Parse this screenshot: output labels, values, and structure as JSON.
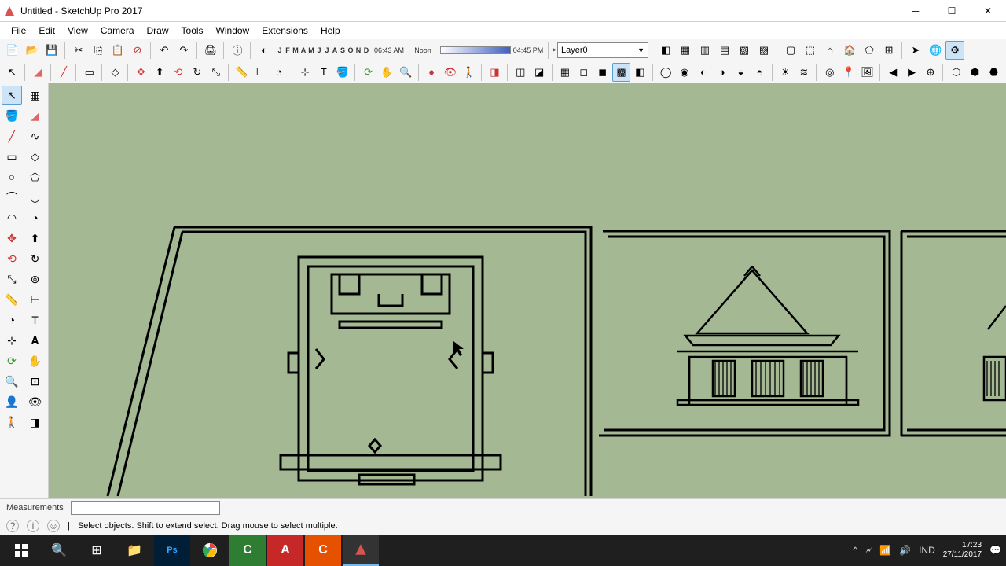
{
  "window": {
    "title": "Untitled - SketchUp Pro 2017"
  },
  "menu": {
    "file": "File",
    "edit": "Edit",
    "view": "View",
    "camera": "Camera",
    "draw": "Draw",
    "tools": "Tools",
    "window": "Window",
    "extensions": "Extensions",
    "help": "Help"
  },
  "shadow": {
    "months": [
      "J",
      "F",
      "M",
      "A",
      "M",
      "J",
      "J",
      "A",
      "S",
      "O",
      "N",
      "D"
    ],
    "time_start": "06:43 AM",
    "noon": "Noon",
    "time_end": "04:45 PM"
  },
  "layer": {
    "selected": "Layer0"
  },
  "icons": {
    "new": "new-file-icon",
    "open": "open-file-icon",
    "save": "save-icon",
    "cut": "cut-icon",
    "copy": "copy-icon",
    "paste": "paste-icon",
    "delete": "delete-icon",
    "undo": "undo-icon",
    "redo": "redo-icon",
    "print": "print-icon",
    "select": "select-icon",
    "eraser": "eraser-icon",
    "line": "line-icon",
    "rect": "rectangle-icon",
    "circle": "circle-icon",
    "arc": "arc-icon",
    "pushpull": "pushpull-icon",
    "move": "move-icon",
    "rotate": "rotate-icon",
    "scale": "scale-icon",
    "offset": "offset-icon",
    "tape": "tape-measure-icon",
    "paint": "paint-bucket-icon",
    "orbit": "orbit-icon",
    "pan": "pan-icon",
    "zoom": "zoom-icon",
    "text": "text-icon",
    "dim": "dimension-icon",
    "section": "section-plane-icon",
    "walk": "walk-icon",
    "look": "look-around-icon"
  },
  "toolbar2_icons": [
    "select-icon",
    "eraser-icon",
    "line-icon",
    "freehand-icon",
    "rect-icon",
    "rotated-rect-icon",
    "arc-icon",
    "pie-icon",
    "flip-icon",
    "pushpull-icon",
    "move-icon",
    "rotate-icon",
    "followme-icon",
    "scale-icon",
    "offset-icon",
    "tape-icon",
    "protractor-icon",
    "axes-icon",
    "dim-icon",
    "text-icon",
    "3dtext-icon",
    "section-icon",
    "orbit-icon",
    "pan-icon",
    "zoom-icon",
    "zoom-window-icon",
    "zoom-extents-icon",
    "prev-view-icon",
    "warehouse-icon",
    "3dwarehouse-icon",
    "components-icon",
    "ext-warehouse-icon",
    "layers-icon",
    "explode-icon",
    "solid-union-icon",
    "solid-subtract-icon",
    "solid-trim-icon",
    "solid-intersect-icon",
    "solid-split-icon",
    "outer-shell-icon",
    "shadow-icon",
    "fog-icon",
    "style-edit-icon",
    "edge-style-icon",
    "face-style-icon",
    "xray-icon",
    "wireframe-icon",
    "hidden-line-icon",
    "shaded-icon",
    "shaded-tex-icon",
    "mono-icon"
  ],
  "status": {
    "hint": "Select objects. Shift to extend select. Drag mouse to select multiple."
  },
  "measurements": {
    "label": "Measurements"
  },
  "taskbar": {
    "apps": [
      "start",
      "search",
      "taskview",
      "explorer",
      "photoshop",
      "chrome",
      "app-green",
      "autocad",
      "app-orange",
      "sketchup"
    ],
    "lang": "IND",
    "time": "17:23",
    "date": "27/11/2017"
  }
}
